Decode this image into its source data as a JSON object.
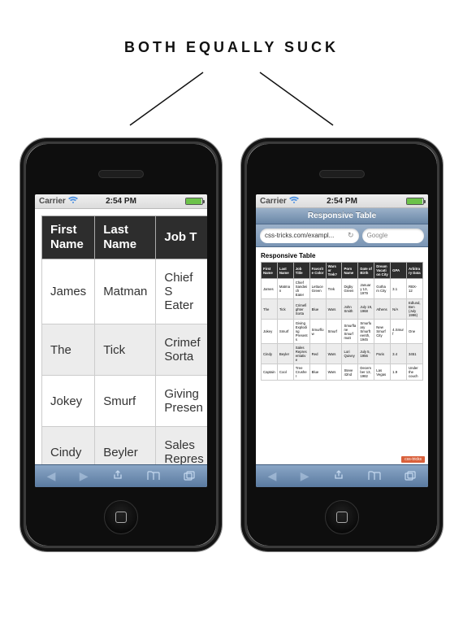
{
  "heading": "BOTH EQUALLY SUCK",
  "status": {
    "carrier": "Carrier",
    "time": "2:54 PM"
  },
  "left_phone": {
    "table": {
      "headers": [
        "First\nName",
        "Last\nName",
        "Job Title"
      ],
      "visible_headers": [
        "First Name",
        "Last Name",
        "Job T"
      ],
      "rows": [
        {
          "first": "James",
          "last": "Matman",
          "job": "Chief Sandwich Eater",
          "job_visible": "Chief S\nEater"
        },
        {
          "first": "The",
          "last": "Tick",
          "job": "Crimefighter Sorta",
          "job_visible": "Crimef\nSorta"
        },
        {
          "first": "Jokey",
          "last": "Smurf",
          "job": "Giving Exploding Presents",
          "job_visible": "Giving\nPresen"
        },
        {
          "first": "Cindy",
          "last": "Beyler",
          "job": "Sales Representative",
          "job_visible": "Sales\nRepres"
        }
      ]
    }
  },
  "right_phone": {
    "nav_title": "Responsive Table",
    "url": "css-tricks.com/exampl...",
    "search_placeholder": "Google",
    "page_heading": "Responsive Table",
    "table": {
      "headers": [
        "First Name",
        "Last Name",
        "Job Title",
        "Favorite Color",
        "Wars or Trek?",
        "Porn Name",
        "Date of Birth",
        "Dream Vacation City",
        "GPA",
        "Arbitrary Data"
      ],
      "rows": [
        [
          "James",
          "Matman",
          "Chief Sandwich Eater",
          "Lettuce Green",
          "Trek",
          "Digby Green",
          "January 13, 1979",
          "Gotham City",
          "3.1",
          "RBX-12"
        ],
        [
          "The",
          "Tick",
          "Crimefighter Sorta",
          "Blue",
          "Wars",
          "John Smith",
          "July 19, 1968",
          "Athens",
          "N/A",
          "Edlund, Ben (July 1996)"
        ],
        [
          "Jokey",
          "Smurf",
          "Giving Exploding Presents",
          "Smurflow",
          "Smurf",
          "Smurflane Smurfmutt",
          "Smurfuary Smurfteenth, 1945",
          "New Smurf City",
          "4.Smurf",
          "One"
        ],
        [
          "Cindy",
          "Beyler",
          "Sales Representative",
          "Red",
          "Wars",
          "Lori Quivey",
          "July 5, 1956",
          "Paris",
          "3.4",
          "3451"
        ],
        [
          "Captain",
          "Cool",
          "Tree Crusher",
          "Blue",
          "Wars",
          "Steve 42nd",
          "December 13, 1982",
          "Las Vegas",
          "1.9",
          "Under the couch"
        ]
      ]
    },
    "badge": "css-tricks"
  },
  "chart_data": {
    "type": "table",
    "title": "Responsive Table",
    "columns": [
      "First Name",
      "Last Name",
      "Job Title",
      "Favorite Color",
      "Wars or Trek?",
      "Porn Name",
      "Date of Birth",
      "Dream Vacation City",
      "GPA",
      "Arbitrary Data"
    ],
    "rows": [
      [
        "James",
        "Matman",
        "Chief Sandwich Eater",
        "Lettuce Green",
        "Trek",
        "Digby Green",
        "January 13, 1979",
        "Gotham City",
        "3.1",
        "RBX-12"
      ],
      [
        "The",
        "Tick",
        "Crimefighter Sorta",
        "Blue",
        "Wars",
        "John Smith",
        "July 19, 1968",
        "Athens",
        "N/A",
        "Edlund, Ben (July 1996)"
      ],
      [
        "Jokey",
        "Smurf",
        "Giving Exploding Presents",
        "Smurflow",
        "Smurf",
        "Smurflane Smurfmutt",
        "Smurfuary Smurfteenth, 1945",
        "New Smurf City",
        "4.Smurf",
        "One"
      ],
      [
        "Cindy",
        "Beyler",
        "Sales Representative",
        "Red",
        "Wars",
        "Lori Quivey",
        "July 5, 1956",
        "Paris",
        "3.4",
        "3451"
      ],
      [
        "Captain",
        "Cool",
        "Tree Crusher",
        "Blue",
        "Wars",
        "Steve 42nd",
        "December 13, 1982",
        "Las Vegas",
        "1.9",
        "Under the couch"
      ]
    ]
  }
}
